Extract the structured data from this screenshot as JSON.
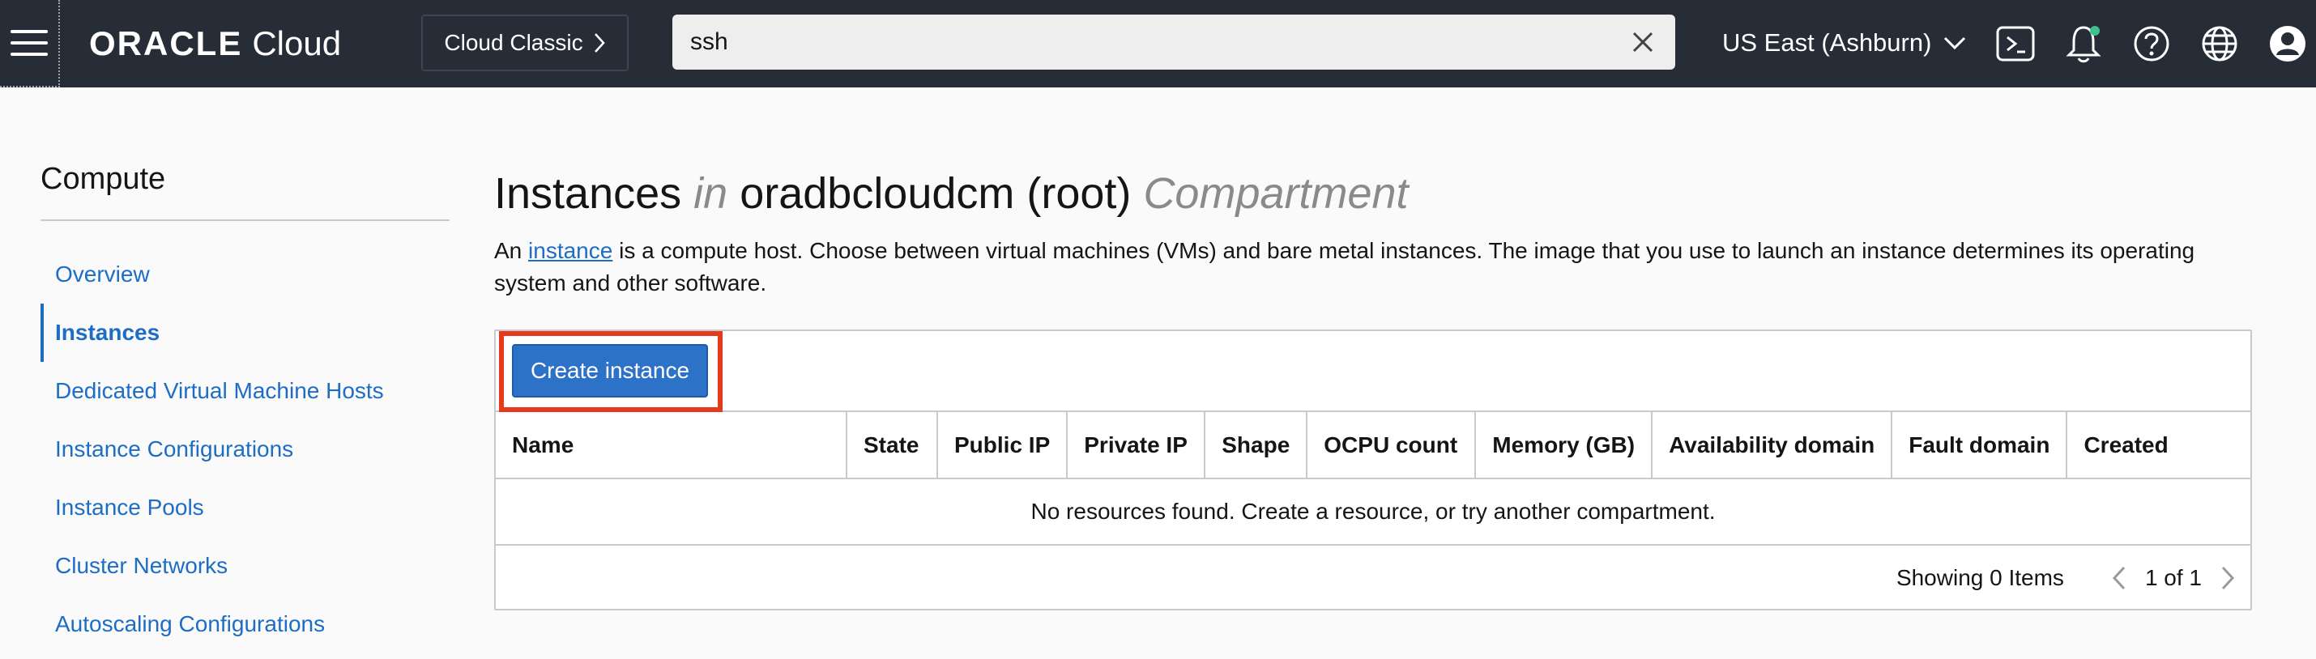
{
  "header": {
    "logo_brand": "ORACLE",
    "logo_product": "Cloud",
    "classic_label": "Cloud Classic",
    "search_value": "ssh",
    "region_label": "US East (Ashburn)",
    "icons": [
      "menu-icon",
      "chevron-right-icon",
      "close-icon",
      "chevron-down-icon",
      "cloud-shell-icon",
      "bell-icon",
      "help-icon",
      "globe-icon",
      "user-icon"
    ],
    "accent_color": "#272d37"
  },
  "sidebar": {
    "title": "Compute",
    "items": [
      {
        "label": "Overview"
      },
      {
        "label": "Instances"
      },
      {
        "label": "Dedicated Virtual Machine Hosts"
      },
      {
        "label": "Instance Configurations"
      },
      {
        "label": "Instance Pools"
      },
      {
        "label": "Cluster Networks"
      },
      {
        "label": "Autoscaling Configurations"
      }
    ],
    "active_item": "Instances"
  },
  "main": {
    "title_resource": "Instances",
    "title_in": "in",
    "title_compartment_name": "oradbcloudcm (root)",
    "title_compartment_word": "Compartment",
    "desc_prefix": "An",
    "desc_link": "instance",
    "desc_rest": "is a compute host. Choose between virtual machines (VMs) and bare metal instances. The image that you use to launch an instance determines its operating system and other software.",
    "create_button": "Create instance",
    "columns": [
      "Name",
      "State",
      "Public IP",
      "Private IP",
      "Shape",
      "OCPU count",
      "Memory (GB)",
      "Availability domain",
      "Fault domain",
      "Created"
    ],
    "empty_message": "No resources found. Create a resource, or try another compartment.",
    "showing_label": "Showing 0 Items",
    "page_label": "1 of 1"
  },
  "colors": {
    "link_blue": "#1d6dc4",
    "button_blue": "#2d72c9",
    "highlight_red": "#e53a1c"
  }
}
